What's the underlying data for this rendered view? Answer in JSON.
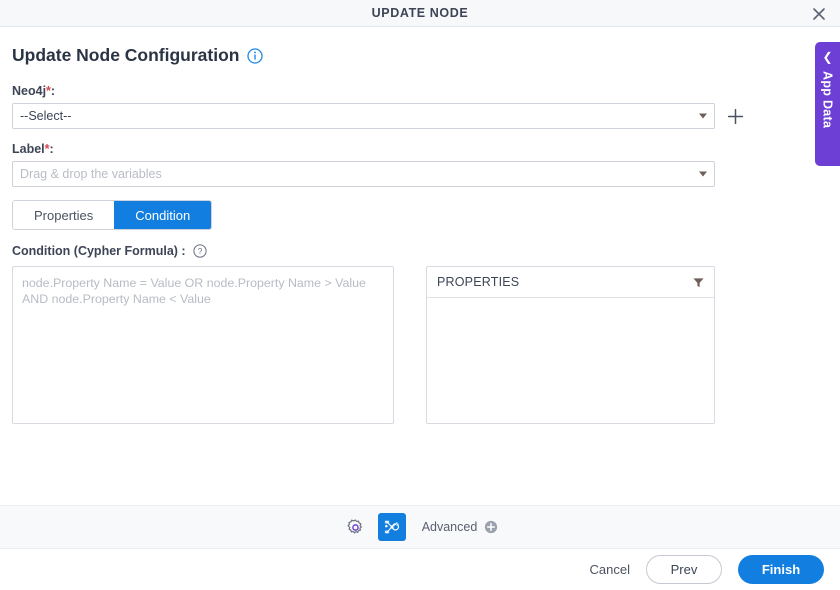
{
  "window": {
    "title": "UPDATE NODE",
    "close_icon": "close-icon"
  },
  "header": {
    "page_title": "Update Node Configuration",
    "info_icon": "info-icon"
  },
  "form": {
    "neo4j": {
      "label": "Neo4j",
      "required_marker": "*",
      "label_suffix": ":",
      "value": "--Select--",
      "caret_icon": "chevron-down-icon",
      "add_icon": "plus-icon"
    },
    "label_field": {
      "label": "Label",
      "required_marker": "*",
      "label_suffix": ":",
      "placeholder": "Drag & drop the variables",
      "caret_icon": "chevron-down-icon"
    }
  },
  "tabs": [
    {
      "label": "Properties",
      "active": false
    },
    {
      "label": "Condition",
      "active": true
    }
  ],
  "condition": {
    "label": "Condition (Cypher Formula) :",
    "help_icon": "question-circle-icon",
    "placeholder": "node.Property Name = Value OR node.Property Name > Value AND node.Property Name < Value"
  },
  "properties_panel": {
    "title": "PROPERTIES",
    "filter_icon": "filter-icon",
    "rows": []
  },
  "toolbar": {
    "settings_icon": "gear-icon",
    "graph_icon": "node-network-icon",
    "advanced_label": "Advanced",
    "advanced_add_icon": "plus-circle-icon"
  },
  "actions": {
    "cancel_label": "Cancel",
    "prev_label": "Prev",
    "finish_label": "Finish"
  },
  "side_tab": {
    "label": "App Data",
    "chevron_icon": "chevron-left-icon"
  },
  "colors": {
    "accent_blue": "#127fe0",
    "purple": "#6d3fd4",
    "required_red": "#d64550",
    "text_dark": "#3d4455"
  }
}
